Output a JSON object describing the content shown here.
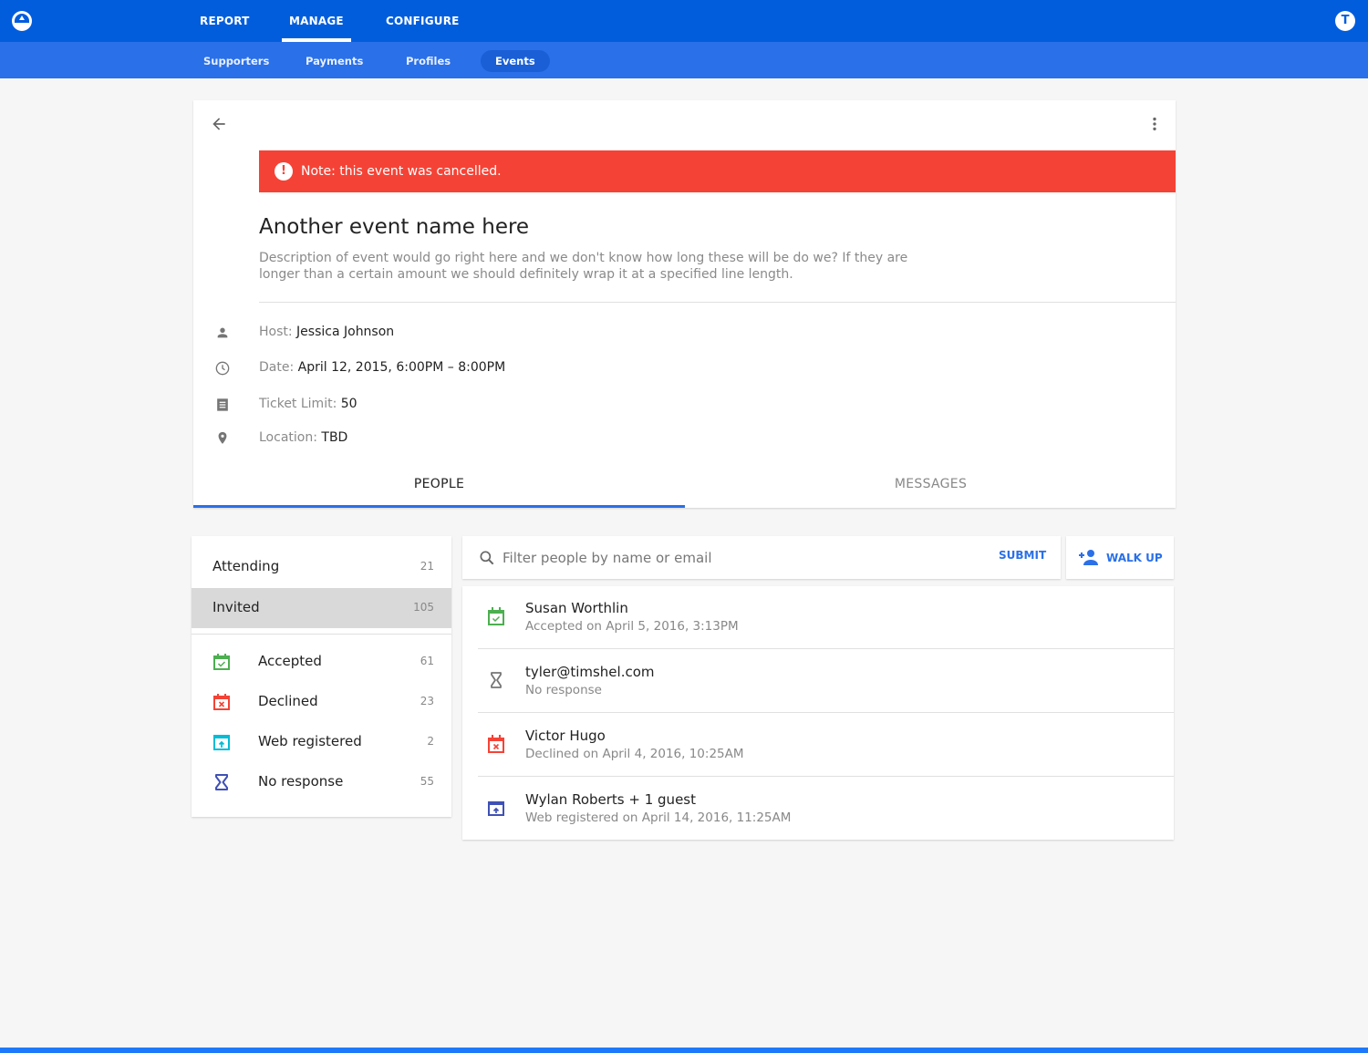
{
  "colors": {
    "topbar": "#025ddd",
    "subbar": "#2a70e8",
    "alert": "#f44336",
    "accent": "#2a70e8",
    "accepted": "#4caf50",
    "declined": "#f44336",
    "web_registered": "#00bcd4",
    "no_response": "#3f51b5"
  },
  "topnav": {
    "logo": "app-logo",
    "items": [
      {
        "label": "REPORT",
        "active": false
      },
      {
        "label": "MANAGE",
        "active": true
      },
      {
        "label": "CONFIGURE",
        "active": false
      }
    ],
    "avatar_initial": "T"
  },
  "subnav": {
    "items": [
      {
        "label": "Supporters",
        "active": false
      },
      {
        "label": "Payments",
        "active": false
      },
      {
        "label": "Profiles",
        "active": false
      },
      {
        "label": "Events",
        "active": true
      }
    ]
  },
  "event": {
    "back_icon": "arrow-left-icon",
    "more_icon": "more-vertical-icon",
    "alert": "Note: this event was cancelled.",
    "alert_icon": "!",
    "title": "Another event name here",
    "description": "Description of event would go right here and we don't know how long these will be do we? If they are longer than a certain amount we should definitely wrap it at a specified line length.",
    "details": [
      {
        "icon": "person-icon",
        "label": "Host:",
        "value": "Jessica Johnson"
      },
      {
        "icon": "clock-icon",
        "label": "Date:",
        "value": "April 12, 2015, 6:00PM – 8:00PM"
      },
      {
        "icon": "ticket-icon",
        "label": "Ticket Limit:",
        "value": "50"
      },
      {
        "icon": "location-pin-icon",
        "label": "Location:",
        "value": "TBD"
      }
    ],
    "tabs": [
      {
        "label": "PEOPLE",
        "active": true
      },
      {
        "label": "MESSAGES",
        "active": false
      }
    ]
  },
  "status_filters": {
    "groups": [
      {
        "label": "Attending",
        "count": "21",
        "selected": false
      },
      {
        "label": "Invited",
        "count": "105",
        "selected": true
      }
    ],
    "statuses": [
      {
        "label": "Accepted",
        "count": "61",
        "icon": "calendar-check-icon"
      },
      {
        "label": "Declined",
        "count": "23",
        "icon": "calendar-x-icon"
      },
      {
        "label": "Web registered",
        "count": "2",
        "icon": "web-register-icon"
      },
      {
        "label": "No response",
        "count": "55",
        "icon": "hourglass-icon"
      }
    ]
  },
  "filter": {
    "placeholder": "Filter people by name or email",
    "value": "",
    "submit_label": "SUBMIT",
    "walkup_label": "WALK UP"
  },
  "people": [
    {
      "name": "Susan Worthlin",
      "status": "Accepted on April 5, 2016, 3:13PM",
      "icon": "calendar-check-icon"
    },
    {
      "name": "tyler@timshel.com",
      "status": "No response",
      "icon": "hourglass-icon"
    },
    {
      "name": "Victor Hugo",
      "status": "Declined on April 4, 2016, 10:25AM",
      "icon": "calendar-x-icon"
    },
    {
      "name": "Wylan Roberts + 1 guest",
      "status": "Web registered on April 14, 2016, 11:25AM",
      "icon": "web-register-icon"
    }
  ]
}
